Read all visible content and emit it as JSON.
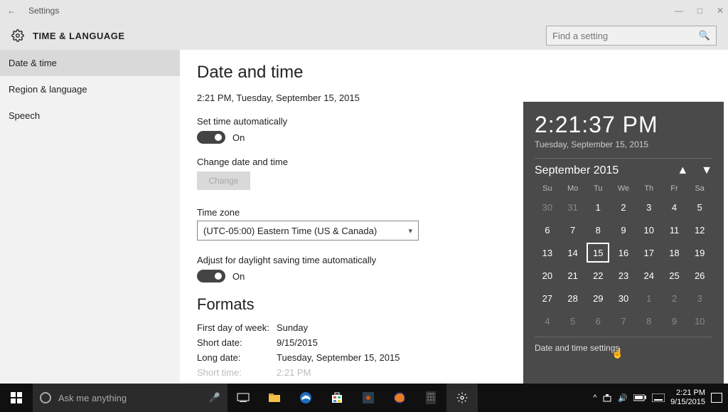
{
  "titlebar": {
    "title": "Settings"
  },
  "header": {
    "section_title": "TIME & LANGUAGE",
    "search_placeholder": "Find a setting"
  },
  "sidebar": {
    "items": [
      {
        "label": "Date & time",
        "selected": true
      },
      {
        "label": "Region & language",
        "selected": false
      },
      {
        "label": "Speech",
        "selected": false
      }
    ]
  },
  "content": {
    "heading": "Date and time",
    "now_line": "2:21 PM, Tuesday, September 15, 2015",
    "set_auto_label": "Set time automatically",
    "set_auto_state": "On",
    "change_label": "Change date and time",
    "change_button": "Change",
    "timezone_label": "Time zone",
    "timezone_value": "(UTC-05:00) Eastern Time (US & Canada)",
    "dst_label": "Adjust for daylight saving time automatically",
    "dst_state": "On",
    "formats_heading": "Formats",
    "formats": {
      "first_day_k": "First day of week:",
      "first_day_v": "Sunday",
      "short_date_k": "Short date:",
      "short_date_v": "9/15/2015",
      "long_date_k": "Long date:",
      "long_date_v": "Tuesday, September 15, 2015",
      "short_time_k": "Short time:",
      "short_time_v": "2:21 PM"
    }
  },
  "flyout": {
    "time": "2:21:37 PM",
    "date": "Tuesday, September 15, 2015",
    "month_label": "September 2015",
    "dow": [
      "Su",
      "Mo",
      "Tu",
      "We",
      "Th",
      "Fr",
      "Sa"
    ],
    "weeks": [
      [
        {
          "d": "30",
          "m": true
        },
        {
          "d": "31",
          "m": true
        },
        {
          "d": "1"
        },
        {
          "d": "2"
        },
        {
          "d": "3"
        },
        {
          "d": "4"
        },
        {
          "d": "5"
        }
      ],
      [
        {
          "d": "6"
        },
        {
          "d": "7"
        },
        {
          "d": "8"
        },
        {
          "d": "9"
        },
        {
          "d": "10"
        },
        {
          "d": "11"
        },
        {
          "d": "12"
        }
      ],
      [
        {
          "d": "13"
        },
        {
          "d": "14"
        },
        {
          "d": "15",
          "t": true
        },
        {
          "d": "16"
        },
        {
          "d": "17"
        },
        {
          "d": "18"
        },
        {
          "d": "19"
        }
      ],
      [
        {
          "d": "20"
        },
        {
          "d": "21"
        },
        {
          "d": "22"
        },
        {
          "d": "23"
        },
        {
          "d": "24"
        },
        {
          "d": "25"
        },
        {
          "d": "26"
        }
      ],
      [
        {
          "d": "27"
        },
        {
          "d": "28"
        },
        {
          "d": "29"
        },
        {
          "d": "30"
        },
        {
          "d": "1",
          "m": true
        },
        {
          "d": "2",
          "m": true
        },
        {
          "d": "3",
          "m": true
        }
      ],
      [
        {
          "d": "4",
          "m": true
        },
        {
          "d": "5",
          "m": true
        },
        {
          "d": "6",
          "m": true
        },
        {
          "d": "7",
          "m": true
        },
        {
          "d": "8",
          "m": true
        },
        {
          "d": "9",
          "m": true
        },
        {
          "d": "10",
          "m": true
        }
      ]
    ],
    "settings_link": "Date and time settings"
  },
  "taskbar": {
    "cortana_placeholder": "Ask me anything",
    "clock_time": "2:21 PM",
    "clock_date": "9/15/2015"
  }
}
